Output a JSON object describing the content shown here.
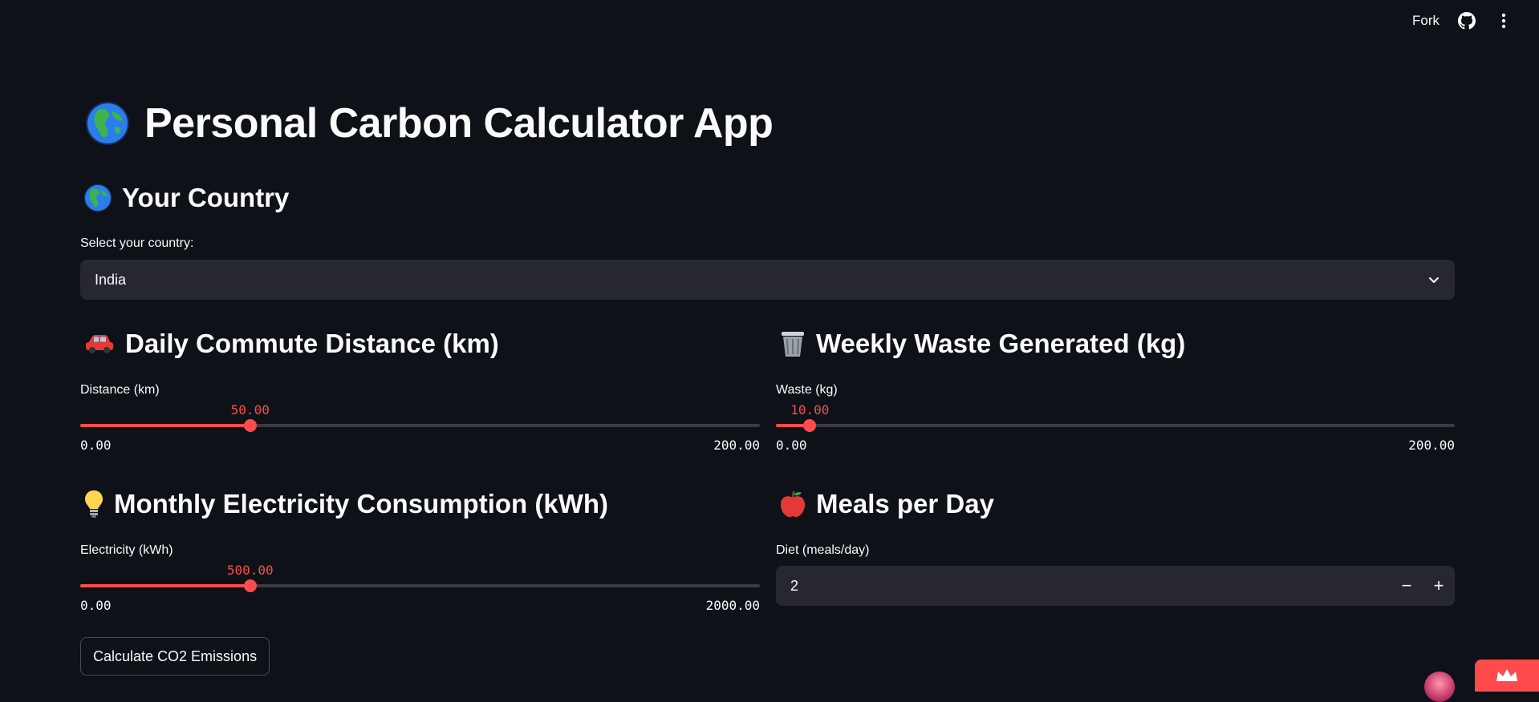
{
  "header": {
    "fork_label": "Fork",
    "github_icon": "github-icon",
    "menu_icon": "kebab-menu-icon"
  },
  "app": {
    "title": "Personal Carbon Calculator App",
    "title_icon": "globe-icon"
  },
  "country": {
    "heading": "Your Country",
    "label": "Select your country:",
    "selected": "India"
  },
  "commute": {
    "heading": "Daily Commute Distance (km)",
    "label": "Distance (km)",
    "value_text": "50.00",
    "min_text": "0.00",
    "max_text": "200.00",
    "value": 50,
    "min": 0,
    "max": 200
  },
  "waste": {
    "heading": "Weekly Waste Generated (kg)",
    "label": "Waste (kg)",
    "value_text": "10.00",
    "min_text": "0.00",
    "max_text": "200.00",
    "value": 10,
    "min": 0,
    "max": 200
  },
  "electricity": {
    "heading": "Monthly Electricity Consumption (kWh)",
    "label": "Electricity (kWh)",
    "value_text": "500.00",
    "min_text": "0.00",
    "max_text": "2000.00",
    "value": 500,
    "min": 0,
    "max": 2000
  },
  "meals": {
    "heading": "Meals per Day",
    "label": "Diet (meals/day)",
    "value": "2",
    "minus": "−",
    "plus": "+"
  },
  "calculate_button": "Calculate CO2 Emissions",
  "colors": {
    "background": "#0e1117",
    "widget": "#262730",
    "accent": "#ff4b4b",
    "text": "#fafafa"
  }
}
